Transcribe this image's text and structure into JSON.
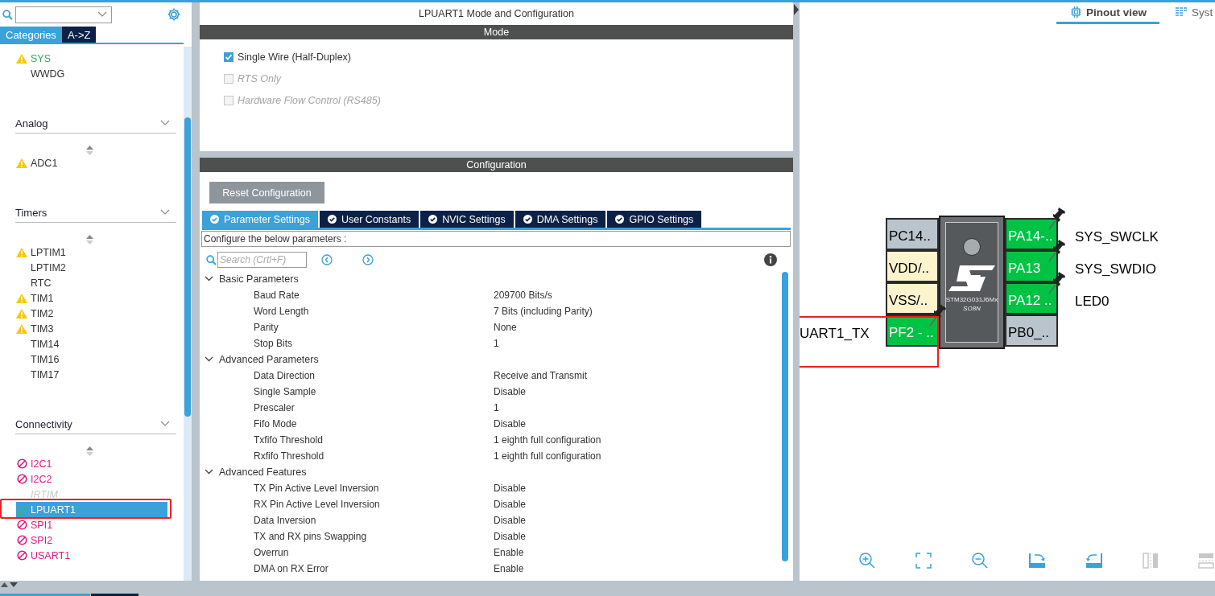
{
  "sidebar": {
    "tabs": [
      {
        "label": "Categories",
        "selected": true
      },
      {
        "label": "A->Z",
        "selected": false
      }
    ],
    "groups": [
      {
        "items": [
          {
            "label": "SYS",
            "kind": "warning",
            "configured": true,
            "selected": false,
            "highlighted": false
          },
          {
            "label": "WWDG",
            "kind": "none",
            "configured": false,
            "selected": false,
            "highlighted": false
          }
        ]
      },
      {
        "title": "Analog",
        "items": [
          {
            "label": "ADC1",
            "kind": "warning",
            "configured": false,
            "selected": false,
            "highlighted": false
          }
        ]
      },
      {
        "title": "Timers",
        "items": [
          {
            "label": "LPTIM1",
            "kind": "warning",
            "configured": false,
            "selected": false,
            "highlighted": false
          },
          {
            "label": "LPTIM2",
            "kind": "none",
            "configured": false,
            "selected": false,
            "highlighted": false
          },
          {
            "label": "RTC",
            "kind": "none",
            "configured": false,
            "selected": false,
            "highlighted": false
          },
          {
            "label": "TIM1",
            "kind": "warning",
            "configured": false,
            "selected": false,
            "highlighted": false
          },
          {
            "label": "TIM2",
            "kind": "warning",
            "configured": false,
            "selected": false,
            "highlighted": false
          },
          {
            "label": "TIM3",
            "kind": "warning",
            "configured": false,
            "selected": false,
            "highlighted": false
          },
          {
            "label": "TIM14",
            "kind": "none",
            "configured": false,
            "selected": false,
            "highlighted": false
          },
          {
            "label": "TIM16",
            "kind": "none",
            "configured": false,
            "selected": false,
            "highlighted": false
          },
          {
            "label": "TIM17",
            "kind": "none",
            "configured": false,
            "selected": false,
            "highlighted": false
          }
        ]
      },
      {
        "title": "Connectivity",
        "items": [
          {
            "label": "I2C1",
            "kind": "blocked",
            "configured": false,
            "selected": false,
            "highlighted": false
          },
          {
            "label": "I2C2",
            "kind": "blocked",
            "configured": false,
            "selected": false,
            "highlighted": false
          },
          {
            "label": "IRTIM",
            "kind": "unavailable",
            "configured": false,
            "selected": false,
            "highlighted": false
          },
          {
            "label": "LPUART1",
            "kind": "ok",
            "configured": true,
            "selected": true,
            "highlighted": true
          },
          {
            "label": "SPI1",
            "kind": "blocked",
            "configured": false,
            "selected": false,
            "highlighted": false
          },
          {
            "label": "SPI2",
            "kind": "blocked",
            "configured": false,
            "selected": false,
            "highlighted": false
          },
          {
            "label": "USART1",
            "kind": "blocked",
            "configured": false,
            "selected": false,
            "highlighted": false
          }
        ]
      }
    ]
  },
  "main": {
    "title": "LPUART1 Mode and Configuration",
    "mode": {
      "heading": "Mode",
      "options": [
        {
          "label": "Single Wire (Half-Duplex)",
          "checked": true,
          "disabled": false
        },
        {
          "label": "RTS Only",
          "checked": false,
          "disabled": true
        },
        {
          "label": "Hardware Flow Control (RS485)",
          "checked": false,
          "disabled": true
        }
      ]
    },
    "configuration": {
      "heading": "Configuration",
      "reset_button": "Reset Configuration",
      "tabs": [
        {
          "label": "Parameter Settings",
          "selected": true
        },
        {
          "label": "User Constants",
          "selected": false
        },
        {
          "label": "NVIC Settings",
          "selected": false
        },
        {
          "label": "DMA Settings",
          "selected": false
        },
        {
          "label": "GPIO Settings",
          "selected": false
        }
      ],
      "description": "Configure the below parameters :",
      "search": {
        "placeholder": "Search (Crtl+F)"
      },
      "groups": [
        {
          "name": "Basic Parameters",
          "expanded": true,
          "params": [
            {
              "name": "Baud Rate",
              "value": "209700 Bits/s"
            },
            {
              "name": "Word Length",
              "value": "7 Bits (including Parity)"
            },
            {
              "name": "Parity",
              "value": "None"
            },
            {
              "name": "Stop Bits",
              "value": "1"
            }
          ]
        },
        {
          "name": "Advanced Parameters",
          "expanded": true,
          "params": [
            {
              "name": "Data Direction",
              "value": "Receive and Transmit"
            },
            {
              "name": "Single Sample",
              "value": "Disable"
            },
            {
              "name": "Prescaler",
              "value": "1"
            },
            {
              "name": "Fifo Mode",
              "value": "Disable"
            },
            {
              "name": "Txfifo Threshold",
              "value": "1 eighth full configuration"
            },
            {
              "name": "Rxfifo Threshold",
              "value": "1 eighth full configuration"
            }
          ]
        },
        {
          "name": "Advanced Features",
          "expanded": true,
          "params": [
            {
              "name": "TX Pin Active Level Inversion",
              "value": "Disable"
            },
            {
              "name": "RX Pin Active Level Inversion",
              "value": "Disable"
            },
            {
              "name": "Data Inversion",
              "value": "Disable"
            },
            {
              "name": "TX and RX pins Swapping",
              "value": "Disable"
            },
            {
              "name": "Overrun",
              "value": "Enable"
            },
            {
              "name": "DMA on RX Error",
              "value": "Enable"
            }
          ]
        }
      ]
    }
  },
  "pinout": {
    "tabs": [
      {
        "label": "Pinout view",
        "selected": true
      },
      {
        "label": "Syst",
        "selected": false
      }
    ],
    "chip": {
      "part": "STM32G031J6Mx",
      "package": "SO8N"
    },
    "left_pins": [
      {
        "name": "PC14..",
        "kind": "unused",
        "pinned": false,
        "highlighted": false
      },
      {
        "name": "VDD/..",
        "kind": "power",
        "pinned": false,
        "highlighted": false
      },
      {
        "name": "VSS/..",
        "kind": "power",
        "pinned": false,
        "highlighted": false
      },
      {
        "name": "PF2 - ..",
        "kind": "assigned",
        "label": "UART1_TX",
        "pinned": true,
        "highlighted": true
      }
    ],
    "right_pins": [
      {
        "name": "PA14-..",
        "kind": "assigned",
        "label": "SYS_SWCLK",
        "pinned": true,
        "highlighted": false
      },
      {
        "name": "PA13",
        "kind": "assigned",
        "label": "SYS_SWDIO",
        "pinned": true,
        "highlighted": false
      },
      {
        "name": "PA12 ..",
        "kind": "assigned",
        "label": "LED0",
        "pinned": true,
        "highlighted": false
      },
      {
        "name": "PB0_..",
        "kind": "unused",
        "pinned": false,
        "highlighted": false
      }
    ]
  }
}
